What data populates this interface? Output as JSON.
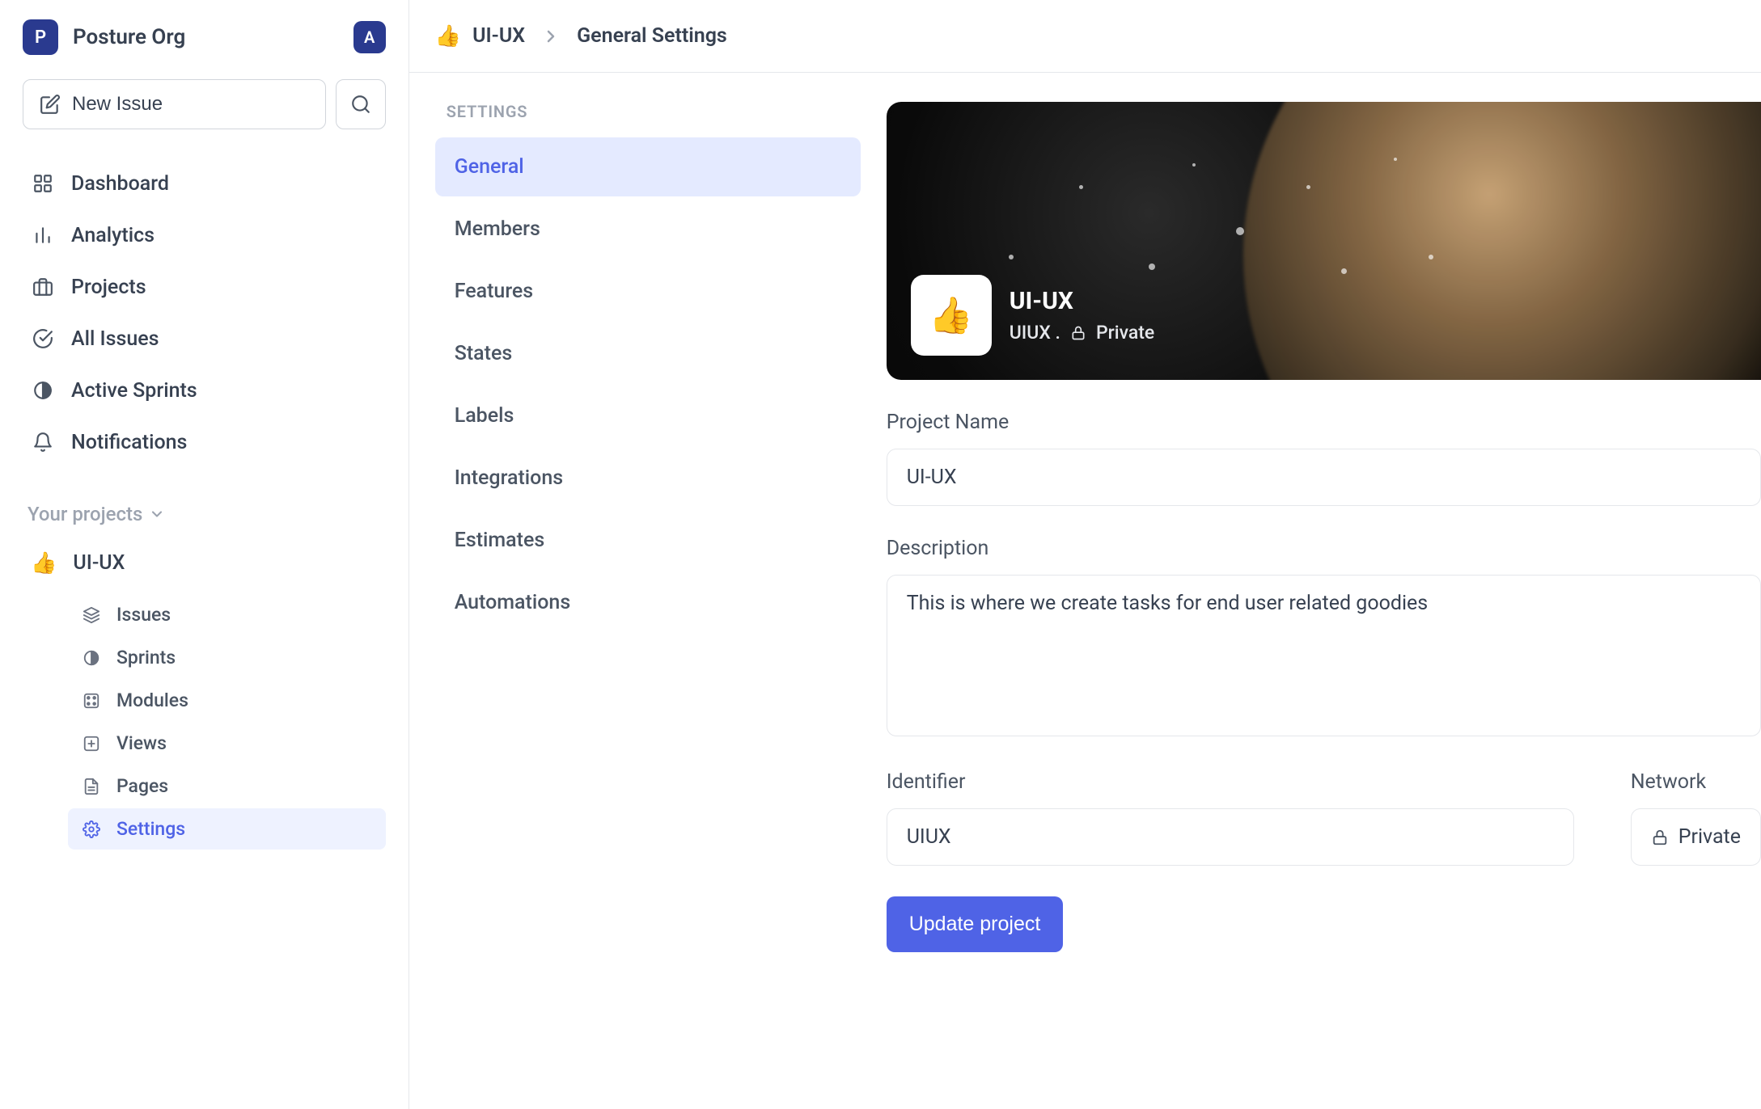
{
  "org": {
    "badge_letter": "P",
    "name": "Posture Org",
    "user_badge_letter": "A"
  },
  "sidebar": {
    "new_issue_label": "New Issue",
    "nav": [
      {
        "label": "Dashboard"
      },
      {
        "label": "Analytics"
      },
      {
        "label": "Projects"
      },
      {
        "label": "All Issues"
      },
      {
        "label": "Active Sprints"
      },
      {
        "label": "Notifications"
      }
    ],
    "projects_header": "Your projects",
    "project": {
      "emoji": "👍",
      "name": "UI-UX",
      "items": [
        {
          "label": "Issues"
        },
        {
          "label": "Sprints"
        },
        {
          "label": "Modules"
        },
        {
          "label": "Views"
        },
        {
          "label": "Pages"
        },
        {
          "label": "Settings"
        }
      ]
    }
  },
  "breadcrumb": {
    "emoji": "👍",
    "project": "UI-UX",
    "page": "General Settings"
  },
  "settings_nav": {
    "heading": "SETTINGS",
    "items": [
      {
        "label": "General"
      },
      {
        "label": "Members"
      },
      {
        "label": "Features"
      },
      {
        "label": "States"
      },
      {
        "label": "Labels"
      },
      {
        "label": "Integrations"
      },
      {
        "label": "Estimates"
      },
      {
        "label": "Automations"
      }
    ]
  },
  "cover": {
    "emoji": "👍",
    "title": "UI-UX",
    "identifier": "UIUX .",
    "visibility": "Private"
  },
  "form": {
    "name_label": "Project Name",
    "name_value": "UI-UX",
    "desc_label": "Description",
    "desc_value": "This is where we create tasks for end user related goodies",
    "ident_label": "Identifier",
    "ident_value": "UIUX",
    "network_label": "Network",
    "network_value": "Private",
    "update_label": "Update project"
  }
}
